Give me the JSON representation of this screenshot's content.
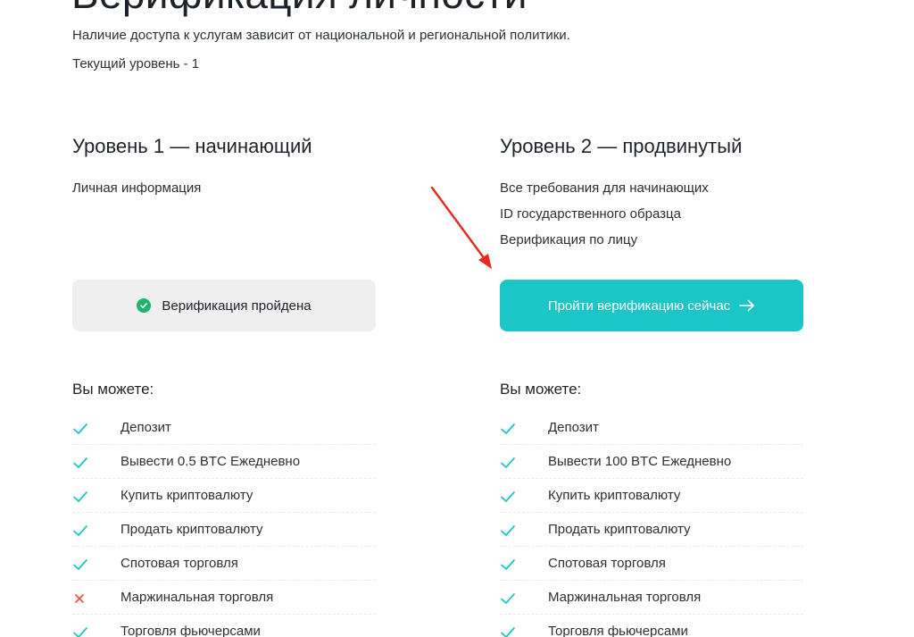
{
  "page": {
    "title": "Верификация личности",
    "policy_note": "Наличие доступа к услугам зависит от национальной и региональной политики.",
    "current_level": "Текущий уровень - 1"
  },
  "colors": {
    "accent": "#1cc6c6",
    "success": "#1ab66b",
    "danger": "#f0573e",
    "annotation": "#e8281c"
  },
  "level1": {
    "title": "Уровень 1 — начинающий",
    "requirements": [
      "Личная информация"
    ],
    "status_label": "Верификация пройдена",
    "status_icon": "check-circle-icon",
    "can_title": "Вы можете:",
    "features": [
      {
        "label": "Депозит",
        "allowed": true
      },
      {
        "label": "Вывести 0.5 BTC Ежедневно",
        "allowed": true
      },
      {
        "label": "Купить криптовалюту",
        "allowed": true
      },
      {
        "label": "Продать криптовалюту",
        "allowed": true
      },
      {
        "label": "Спотовая торговля",
        "allowed": true
      },
      {
        "label": "Маржинальная торговля",
        "allowed": false
      },
      {
        "label": "Торговля фьючерсами",
        "allowed": true
      }
    ]
  },
  "level2": {
    "title": "Уровень 2 — продвинутый",
    "requirements": [
      "Все требования для начинающих",
      "ID государственного образца",
      "Верификация по лицу"
    ],
    "action_label": "Пройти верификацию сейчас",
    "action_icon": "arrow-right-icon",
    "can_title": "Вы можете:",
    "features": [
      {
        "label": "Депозит",
        "allowed": true
      },
      {
        "label": "Вывести 100 BTC Ежедневно",
        "allowed": true
      },
      {
        "label": "Купить криптовалюту",
        "allowed": true
      },
      {
        "label": "Продать криптовалюту",
        "allowed": true
      },
      {
        "label": "Спотовая торговля",
        "allowed": true
      },
      {
        "label": "Маржинальная торговля",
        "allowed": true
      },
      {
        "label": "Торговля фьючерсами",
        "allowed": true
      }
    ]
  }
}
